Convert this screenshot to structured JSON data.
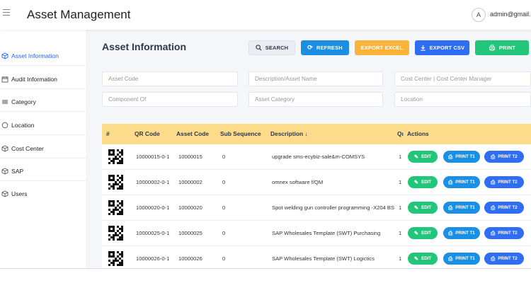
{
  "header": {
    "title": "Asset Management",
    "avatar_initial": "A",
    "user_email": "admin@gmail.co"
  },
  "sidebar": {
    "items": [
      {
        "label": "Asset Information",
        "icon": "cube-icon",
        "active": true
      },
      {
        "label": "Audit Information",
        "icon": "calendar-icon",
        "active": false
      },
      {
        "label": "Category",
        "icon": "list-icon",
        "active": false
      },
      {
        "label": "Location",
        "icon": "circle-icon",
        "active": false
      },
      {
        "label": "Cost Center",
        "icon": "cube-icon",
        "active": false
      },
      {
        "label": "SAP",
        "icon": "cube-icon",
        "active": false
      },
      {
        "label": "Users",
        "icon": "cube-icon",
        "active": false
      }
    ]
  },
  "main": {
    "title": "Asset Information",
    "buttons": {
      "search": "SEARCH",
      "refresh": "REFRESH",
      "export_excel": "EXPORT EXCEL",
      "export_csv": "EXPORT CSV",
      "print": "PRINT"
    },
    "filters": {
      "asset_code": "Asset Code",
      "description": "Description/Asset Name",
      "cost_center": "Cost Center | Cost Center Manager",
      "component_of": "Component Of",
      "asset_category": "Asset Category",
      "location": "Location"
    },
    "table": {
      "columns": {
        "num": "#",
        "qr_code": "QR Code",
        "asset_code": "Asset Code",
        "sub_sequence": "Sub Sequence",
        "description": "Description",
        "qty": "Qı",
        "actions": "Actions"
      },
      "sort_indicator": "↓",
      "action_labels": {
        "edit": "EDIT",
        "print_t1": "PRINT T1",
        "print_t2": "PRINT T2"
      },
      "rows": [
        {
          "qr": "10000015-0-1",
          "asset_code": "10000015",
          "sub_sequence": "0",
          "description": "upgrade sms-ecybiz-sale&m-COMSYS",
          "qty": "1"
        },
        {
          "qr": "10000002-0-1",
          "asset_code": "10000002",
          "sub_sequence": "0",
          "description": "omnex software f/QM",
          "qty": "1"
        },
        {
          "qr": "10000020-0-1",
          "asset_code": "10000020",
          "sub_sequence": "0",
          "description": "Spot welding gun controller programming -X204 BS",
          "qty": "1"
        },
        {
          "qr": "10000025-0-1",
          "asset_code": "10000025",
          "sub_sequence": "0",
          "description": "SAP Wholesales Template (SWT) Purchasing",
          "qty": "1"
        },
        {
          "qr": "10000026-0-1",
          "asset_code": "10000026",
          "sub_sequence": "0",
          "description": "SAP Wholesales Template (SWT) Logictics",
          "qty": "1"
        }
      ]
    }
  },
  "colors": {
    "accent": "#1e5eff",
    "table_header": "#fcdc8a",
    "refresh": "#1a8fe3",
    "excel": "#fbb33a",
    "csv": "#2f6df2",
    "print": "#21c67b"
  }
}
